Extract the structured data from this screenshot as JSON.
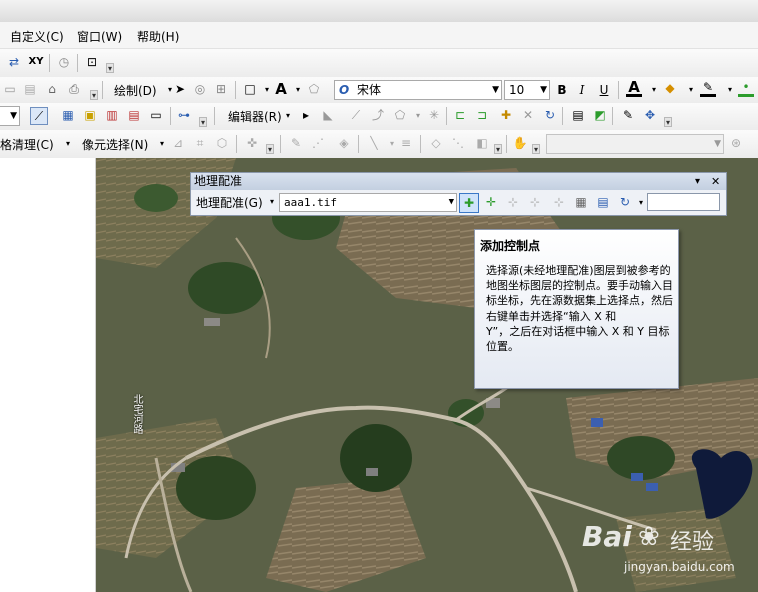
{
  "menubar": {
    "items": [
      "自定义(C)",
      "窗口(W)",
      "帮助(H)"
    ]
  },
  "draw_toolbar": {
    "draw_label": "绘制(D)",
    "font_name": "宋体",
    "font_size": "10",
    "bold": "B",
    "italic": "I",
    "underline": "U",
    "font_color_glyph": "A"
  },
  "editor_toolbar": {
    "editor_label": "编辑器(R)"
  },
  "generalize_toolbar": {
    "grid_clean_label": "格清理(C)",
    "pixel_select_label": "像元选择(N)"
  },
  "georef_panel": {
    "title": "地理配准",
    "menu_label": "地理配准(G)",
    "layer_value": "aaa1.tif",
    "close_glyph": "✕",
    "options_glyph": "▾"
  },
  "tooltip": {
    "title": "添加控制点",
    "body": "选择源(未经地理配准)图层到被参考的地图坐标图层的控制点。要手动输入目标坐标，先在源数据集上选择点，然后右键单击并选择“输入 X 和\nY”，之后在对话框中输入 X 和 Y 目标位置。"
  },
  "map": {
    "road_label": "北宅河路"
  },
  "watermark": {
    "brand_prefix": "Bai",
    "brand_suffix": "经验",
    "url": "jingyan.baidu.com"
  },
  "colors": {
    "accent_blue": "#2a5db0",
    "tooltip_border": "#8d98ad",
    "terrain_green": "#5b6147"
  }
}
